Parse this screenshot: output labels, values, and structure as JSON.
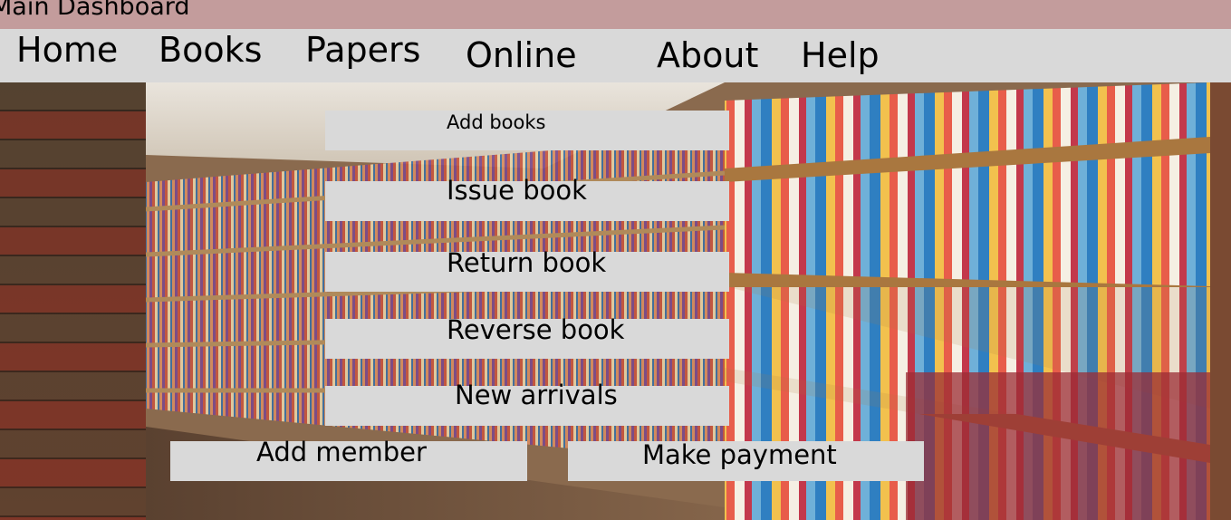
{
  "window": {
    "title": "Main Dashboard"
  },
  "nav": {
    "home": "Home",
    "books": "Books",
    "papers": "Papers",
    "online": "Online",
    "about": "About",
    "help": "Help"
  },
  "actions": {
    "add_books": "Add books",
    "issue_book": "Issue book",
    "return_book": "Return book",
    "reverse_book": "Reverse book",
    "new_arrivals": "New arrivals",
    "add_member": "Add member",
    "make_payment": "Make payment"
  },
  "colors": {
    "titlebar": "#c39c9c",
    "navbar": "#d9d9d9",
    "button": "#d9d9d9"
  }
}
